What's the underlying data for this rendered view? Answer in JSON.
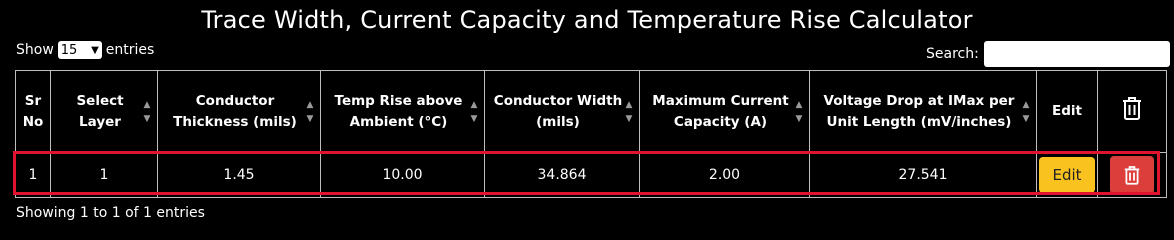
{
  "title": "Trace Width, Current Capacity and Temperature Rise Calculator",
  "length_menu": {
    "show_label": "Show",
    "selected": "15",
    "entries_label": "entries"
  },
  "search": {
    "label": "Search:",
    "value": ""
  },
  "table": {
    "headers": [
      "Sr No",
      "Select Layer",
      "Conductor Thickness (mils)",
      "Temp Rise above Ambient (°C)",
      "Conductor Width (mils)",
      "Maximum Current Capacity (A)",
      "Voltage Drop at IMax per Unit Length (mV/inches)",
      "Edit",
      ""
    ],
    "rows": [
      {
        "sr": "1",
        "layer": "1",
        "thickness": "1.45",
        "temp_rise": "10.00",
        "width": "34.864",
        "current": "2.00",
        "voltage_drop": "27.541",
        "edit_label": "Edit"
      }
    ]
  },
  "footer": {
    "info": "Showing 1 to 1 of 1 entries"
  },
  "colors": {
    "background": "#000000",
    "edit_button": "#f9c21f",
    "delete_button": "#dc3f3b",
    "highlight": "#e0142c"
  }
}
